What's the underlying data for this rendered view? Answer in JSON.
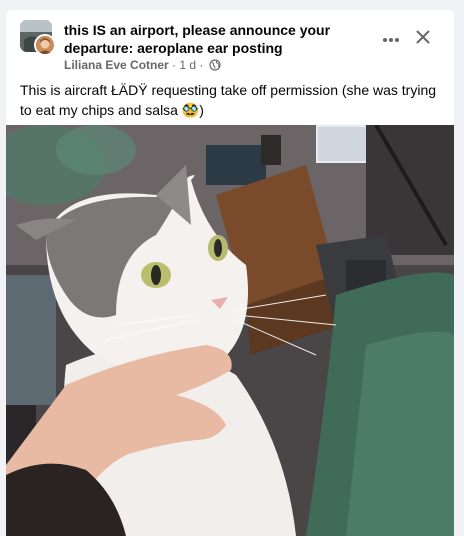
{
  "post": {
    "group_name": "this IS an airport, please announce your departure: aeroplane ear posting",
    "author": "Liliana Eve Cotner",
    "separator": " · ",
    "time": "1 d",
    "separator2": " · ",
    "text": "This is aircraft ŁÄDŸ requesting take off permission (she was trying to eat my chips and salsa 🥸)",
    "photo_subject": "gray and white cat",
    "privacy_icon": "globe-icon"
  },
  "header_actions": {
    "more_icon": "more-options-icon",
    "close_icon": "close-icon"
  },
  "colors": {
    "primary_text": "#050505",
    "secondary_text": "#65676b",
    "background": "#f0f2f5",
    "card": "#ffffff"
  }
}
